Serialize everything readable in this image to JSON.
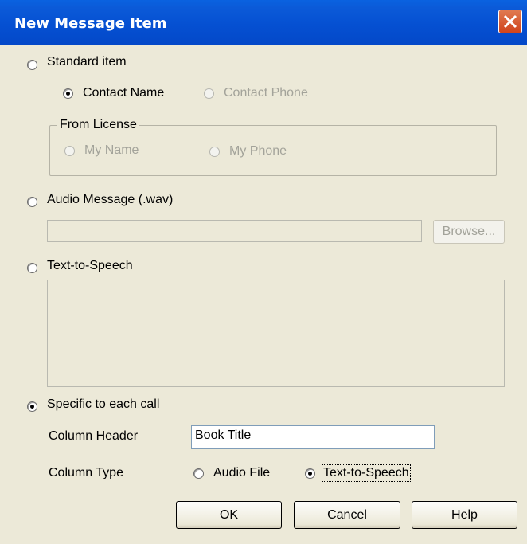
{
  "window": {
    "title": "New Message Item"
  },
  "options": {
    "standard_item": "Standard item",
    "contact_name": "Contact Name",
    "contact_phone": "Contact Phone",
    "from_license": "From License",
    "my_name": "My Name",
    "my_phone": "My Phone",
    "audio_message": "Audio Message (.wav)",
    "browse": "Browse...",
    "text_to_speech": "Text-to-Speech",
    "specific": "Specific to each call",
    "column_header_label": "Column Header",
    "column_header_value": "Book Title",
    "column_type_label": "Column Type",
    "audio_file": "Audio File",
    "tts_option": "Text-to-Speech"
  },
  "buttons": {
    "ok": "OK",
    "cancel": "Cancel",
    "help": "Help"
  },
  "state": {
    "selected_mode": "Specific to each call",
    "selected_standard_sub": "Contact Name",
    "selected_column_type": "Text-to-Speech"
  },
  "colors": {
    "titlebar": "#0550d2",
    "dialog_bg": "#ece9d8",
    "close": "#d0441c"
  }
}
